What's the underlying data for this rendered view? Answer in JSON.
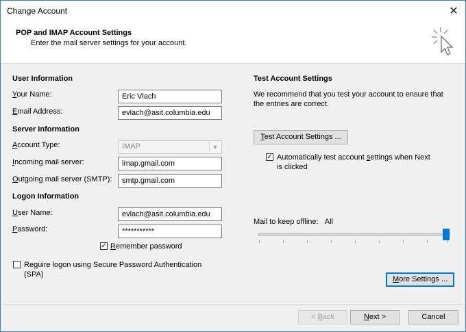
{
  "window": {
    "title": "Change Account"
  },
  "header": {
    "title": "POP and IMAP Account Settings",
    "subtitle": "Enter the mail server settings for your account."
  },
  "user_info": {
    "heading": "User Information",
    "name_label_u": "Y",
    "name_label_rest": "our Name:",
    "name_value": "Eric Vlach",
    "email_label_u": "E",
    "email_label_rest": "mail Address:",
    "email_value": "evlach@asit.columbia.edu"
  },
  "server_info": {
    "heading": "Server Information",
    "account_type_label_u": "A",
    "account_type_label_rest": "ccount Type:",
    "account_type_value": "IMAP",
    "incoming_label_u": "I",
    "incoming_label_rest": "ncoming mail server:",
    "incoming_value": "imap.gmail.com",
    "outgoing_label_u": "O",
    "outgoing_label_rest": "utgoing mail server (SMTP):",
    "outgoing_value": "smtp.gmail.com"
  },
  "logon_info": {
    "heading": "Logon Information",
    "username_label_u": "U",
    "username_label_rest": "ser Name:",
    "username_value": "evlach@asit.columbia.edu",
    "password_label_u": "P",
    "password_label_rest": "assword:",
    "password_value": "***********",
    "remember_label_u": "R",
    "remember_label_rest": "emember password",
    "remember_checked": true,
    "spa_label_u": "q",
    "spa_label_pre": "Re",
    "spa_label_rest": "uire logon using Secure Password Authentication",
    "spa_label_line2": "(SPA)",
    "spa_checked": false
  },
  "test_settings": {
    "heading": "Test Account Settings",
    "description_line1": "We recommend that you test your account to ensure that",
    "description_line2": "the entries are correct.",
    "button_u": "T",
    "button_rest": "est Account Settings ...",
    "auto_label_pre": "Automatically test account ",
    "auto_label_u": "s",
    "auto_label_rest": "ettings when Next",
    "auto_label_line2": "is clicked",
    "auto_checked": true
  },
  "offline": {
    "label": "Mail to keep offline:",
    "value": "All",
    "slider_fraction": 1.0
  },
  "more_settings": {
    "u": "M",
    "rest": "ore Settings ..."
  },
  "footer": {
    "back_pre": "< ",
    "back_u": "B",
    "back_rest": "ack",
    "next_u": "N",
    "next_rest": "ext >",
    "cancel": "Cancel"
  },
  "colors": {
    "accent": "#0078d7",
    "border": "#3c7fb1"
  },
  "icons": {
    "close": "close-icon",
    "header": "cursor-sparkle-icon",
    "dropdown": "chevron-down-icon",
    "check": "checkmark-icon"
  }
}
